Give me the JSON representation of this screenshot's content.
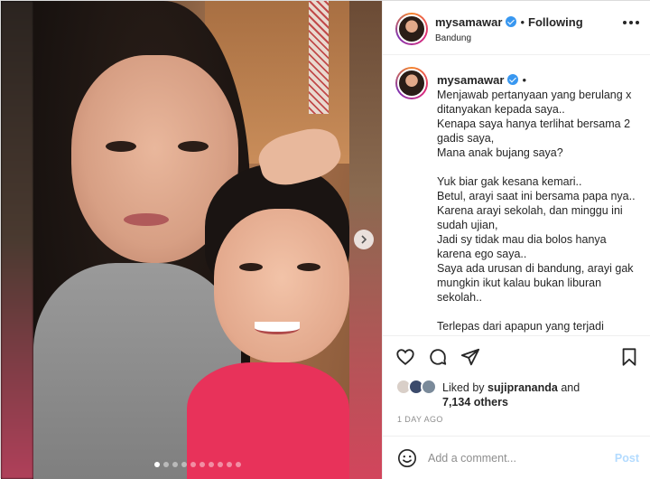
{
  "post": {
    "username": "mysamawar",
    "follow_status": "Following",
    "location": "Bandung",
    "separator": "•",
    "caption_username": "mysamawar",
    "caption_text": "Menjawab pertanyaan yang berulang x ditanyakan kepada saya..\nKenapa saya hanya terlihat bersama 2 gadis saya,\nMana anak bujang saya?\n\nYuk biar gak kesana kemari..\nBetul, arayi saat ini bersama papa nya..\nKarena arayi sekolah, dan minggu ini sudah ujian,\nJadi sy tidak mau dia bolos hanya karena ego saya..\nSaya ada urusan di bandung, arayi gak mungkin ikut kalau bukan liburan sekolah..\n\nTerlepas dari apapun yang terjadi",
    "liked_by_prefix": "Liked by",
    "liked_by_user": "sujiprananda",
    "liked_by_and": "and",
    "likes_others": "7,134 others",
    "timestamp": "1 DAY AGO",
    "comment_placeholder": "Add a comment...",
    "post_button": "Post"
  },
  "carousel": {
    "total_slides": 10,
    "active_index": 0
  },
  "icons": {
    "like": "heart-icon",
    "comment": "comment-icon",
    "share": "share-icon",
    "save": "bookmark-icon",
    "emoji": "smiley-icon",
    "next": "chevron-right-icon",
    "more": "more-options-icon"
  },
  "colors": {
    "verified": "#3897f0",
    "post_button_disabled": "#b3dbff",
    "muted_text": "#8e8e8e"
  }
}
